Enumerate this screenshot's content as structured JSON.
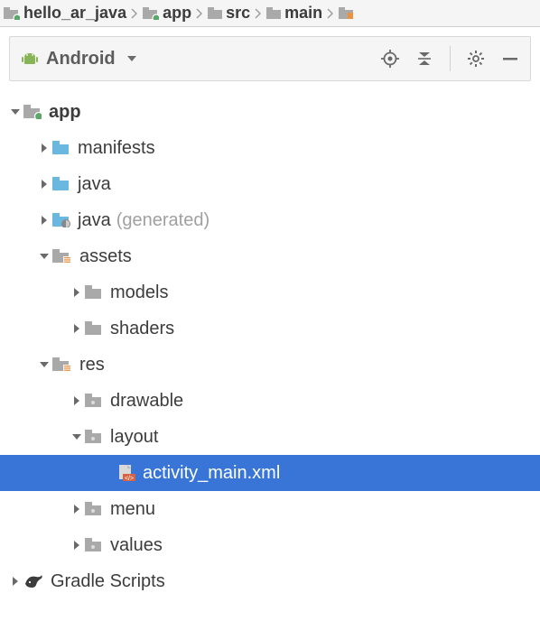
{
  "breadcrumb": [
    {
      "label": "hello_ar_java",
      "iconType": "module-green"
    },
    {
      "label": "app",
      "iconType": "module-green"
    },
    {
      "label": "src",
      "iconType": "folder-grey"
    },
    {
      "label": "main",
      "iconType": "folder-grey"
    }
  ],
  "panel": {
    "title": "Android"
  },
  "tree": [
    {
      "id": "app",
      "label": "app",
      "iconType": "module-green",
      "indent": 0,
      "arrow": "down",
      "bold": true
    },
    {
      "id": "manifests",
      "label": "manifests",
      "iconType": "folder-blue",
      "indent": 1,
      "arrow": "right"
    },
    {
      "id": "java",
      "label": "java",
      "iconType": "folder-blue",
      "indent": 1,
      "arrow": "right"
    },
    {
      "id": "java-gen",
      "label": "java",
      "suffix": "(generated)",
      "iconType": "folder-gen",
      "indent": 1,
      "arrow": "right"
    },
    {
      "id": "assets",
      "label": "assets",
      "iconType": "folder-res",
      "indent": 1,
      "arrow": "down"
    },
    {
      "id": "models",
      "label": "models",
      "iconType": "folder-grey",
      "indent": 2,
      "arrow": "right"
    },
    {
      "id": "shaders",
      "label": "shaders",
      "iconType": "folder-grey",
      "indent": 2,
      "arrow": "right"
    },
    {
      "id": "res",
      "label": "res",
      "iconType": "folder-res",
      "indent": 1,
      "arrow": "down"
    },
    {
      "id": "drawable",
      "label": "drawable",
      "iconType": "folder-grey-dot",
      "indent": 2,
      "arrow": "right"
    },
    {
      "id": "layout",
      "label": "layout",
      "iconType": "folder-grey-dot",
      "indent": 2,
      "arrow": "down"
    },
    {
      "id": "activity_main",
      "label": "activity_main.xml",
      "iconType": "xml-file",
      "indent": 3,
      "arrow": "none",
      "selected": true
    },
    {
      "id": "menu",
      "label": "menu",
      "iconType": "folder-grey-dot",
      "indent": 2,
      "arrow": "right"
    },
    {
      "id": "values",
      "label": "values",
      "iconType": "folder-grey-dot",
      "indent": 2,
      "arrow": "right"
    },
    {
      "id": "gradle-scripts",
      "label": "Gradle Scripts",
      "iconType": "gradle",
      "indent": 0,
      "arrow": "right"
    }
  ]
}
